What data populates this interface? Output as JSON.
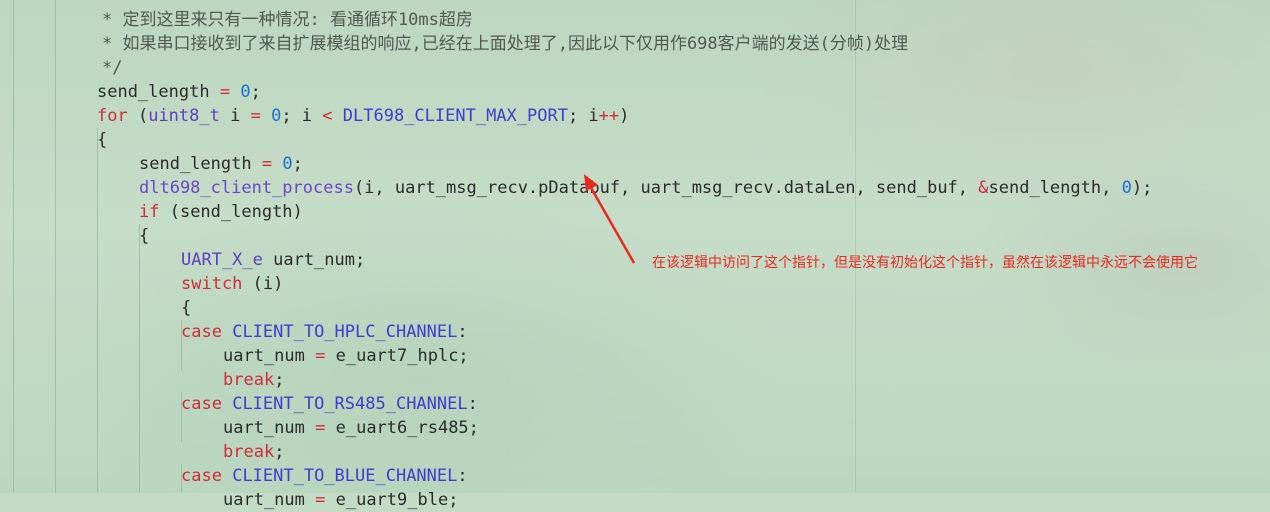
{
  "code_lines": [
    {
      "indent": 102,
      "tokens": [
        {
          "t": "* 定到这里来只有一种情况: 看通循环10ms超房",
          "c": "cm"
        }
      ]
    },
    {
      "indent": 102,
      "tokens": [
        {
          "t": "* 如果串口接收到了来自扩展模组的响应,已经在上面处理了,因此以下仅用作698客户端的发送(分帧)处理",
          "c": "cm"
        }
      ]
    },
    {
      "indent": 102,
      "tokens": [
        {
          "t": "*/",
          "c": "cm"
        }
      ]
    },
    {
      "indent": 97,
      "tokens": [
        {
          "t": "send_length ",
          "c": ""
        },
        {
          "t": "=",
          "c": "op"
        },
        {
          "t": " ",
          "c": ""
        },
        {
          "t": "0",
          "c": "num"
        },
        {
          "t": ";",
          "c": ""
        }
      ]
    },
    {
      "indent": 97,
      "tokens": [
        {
          "t": "for",
          "c": "kw"
        },
        {
          "t": " (",
          "c": ""
        },
        {
          "t": "uint8_t",
          "c": "type"
        },
        {
          "t": " i ",
          "c": ""
        },
        {
          "t": "=",
          "c": "op"
        },
        {
          "t": " ",
          "c": ""
        },
        {
          "t": "0",
          "c": "num"
        },
        {
          "t": "; i ",
          "c": ""
        },
        {
          "t": "<",
          "c": "op"
        },
        {
          "t": " ",
          "c": ""
        },
        {
          "t": "DLT698_CLIENT_MAX_PORT",
          "c": "macro"
        },
        {
          "t": "; i",
          "c": ""
        },
        {
          "t": "++",
          "c": "op"
        },
        {
          "t": ")",
          "c": ""
        }
      ]
    },
    {
      "indent": 97,
      "tokens": [
        {
          "t": "{",
          "c": ""
        }
      ]
    },
    {
      "indent": 139,
      "tokens": [
        {
          "t": "send_length ",
          "c": ""
        },
        {
          "t": "=",
          "c": "op"
        },
        {
          "t": " ",
          "c": ""
        },
        {
          "t": "0",
          "c": "num"
        },
        {
          "t": ";",
          "c": ""
        }
      ]
    },
    {
      "indent": 139,
      "tokens": [
        {
          "t": "dlt698_client_process",
          "c": "fn"
        },
        {
          "t": "(i, uart_msg_recv.pDatabuf, uart_msg_recv.dataLen, send_buf, ",
          "c": ""
        },
        {
          "t": "&",
          "c": "op"
        },
        {
          "t": "send_length, ",
          "c": ""
        },
        {
          "t": "0",
          "c": "num"
        },
        {
          "t": ");",
          "c": ""
        }
      ]
    },
    {
      "indent": 139,
      "tokens": [
        {
          "t": "if",
          "c": "kw"
        },
        {
          "t": " (send_length)",
          "c": ""
        }
      ]
    },
    {
      "indent": 139,
      "tokens": [
        {
          "t": "{",
          "c": ""
        }
      ]
    },
    {
      "indent": 181,
      "tokens": [
        {
          "t": "UART_X_e",
          "c": "type"
        },
        {
          "t": " uart_num;",
          "c": ""
        }
      ]
    },
    {
      "indent": 181,
      "tokens": [
        {
          "t": "switch",
          "c": "kw"
        },
        {
          "t": " (i)",
          "c": ""
        }
      ]
    },
    {
      "indent": 181,
      "tokens": [
        {
          "t": "{",
          "c": ""
        }
      ]
    },
    {
      "indent": 181,
      "tokens": [
        {
          "t": "case",
          "c": "kw"
        },
        {
          "t": " ",
          "c": ""
        },
        {
          "t": "CLIENT_TO_HPLC_CHANNEL",
          "c": "macro"
        },
        {
          "t": ":",
          "c": ""
        }
      ]
    },
    {
      "indent": 223,
      "tokens": [
        {
          "t": "uart_num ",
          "c": ""
        },
        {
          "t": "=",
          "c": "op"
        },
        {
          "t": " e_uart7_hplc;",
          "c": ""
        }
      ]
    },
    {
      "indent": 223,
      "tokens": [
        {
          "t": "break",
          "c": "kw"
        },
        {
          "t": ";",
          "c": ""
        }
      ]
    },
    {
      "indent": 181,
      "tokens": [
        {
          "t": "case",
          "c": "kw"
        },
        {
          "t": " ",
          "c": ""
        },
        {
          "t": "CLIENT_TO_RS485_CHANNEL",
          "c": "macro"
        },
        {
          "t": ":",
          "c": ""
        }
      ]
    },
    {
      "indent": 223,
      "tokens": [
        {
          "t": "uart_num ",
          "c": ""
        },
        {
          "t": "=",
          "c": "op"
        },
        {
          "t": " e_uart6_rs485;",
          "c": ""
        }
      ]
    },
    {
      "indent": 223,
      "tokens": [
        {
          "t": "break",
          "c": "kw"
        },
        {
          "t": ";",
          "c": ""
        }
      ]
    },
    {
      "indent": 181,
      "tokens": [
        {
          "t": "case",
          "c": "kw"
        },
        {
          "t": " ",
          "c": ""
        },
        {
          "t": "CLIENT_TO_BLUE_CHANNEL",
          "c": "macro"
        },
        {
          "t": ":",
          "c": ""
        }
      ]
    },
    {
      "indent": 223,
      "tokens": [
        {
          "t": "uart_num ",
          "c": ""
        },
        {
          "t": "=",
          "c": "op"
        },
        {
          "t": " e_uart9_ble;",
          "c": ""
        }
      ]
    }
  ],
  "annotation": {
    "text": "在该逻辑中访问了这个指针，但是没有初始化这个指针，虽然在该逻辑中永远不会使用它",
    "color": "#e8291f"
  },
  "colors": {
    "keyword": "#cf2b3d",
    "type": "#5b3fc4",
    "number": "#1b6fd0",
    "function": "#6a47c7",
    "macro": "#3a3fcf",
    "comment": "#4f5a52",
    "text": "#2b2b2b"
  }
}
